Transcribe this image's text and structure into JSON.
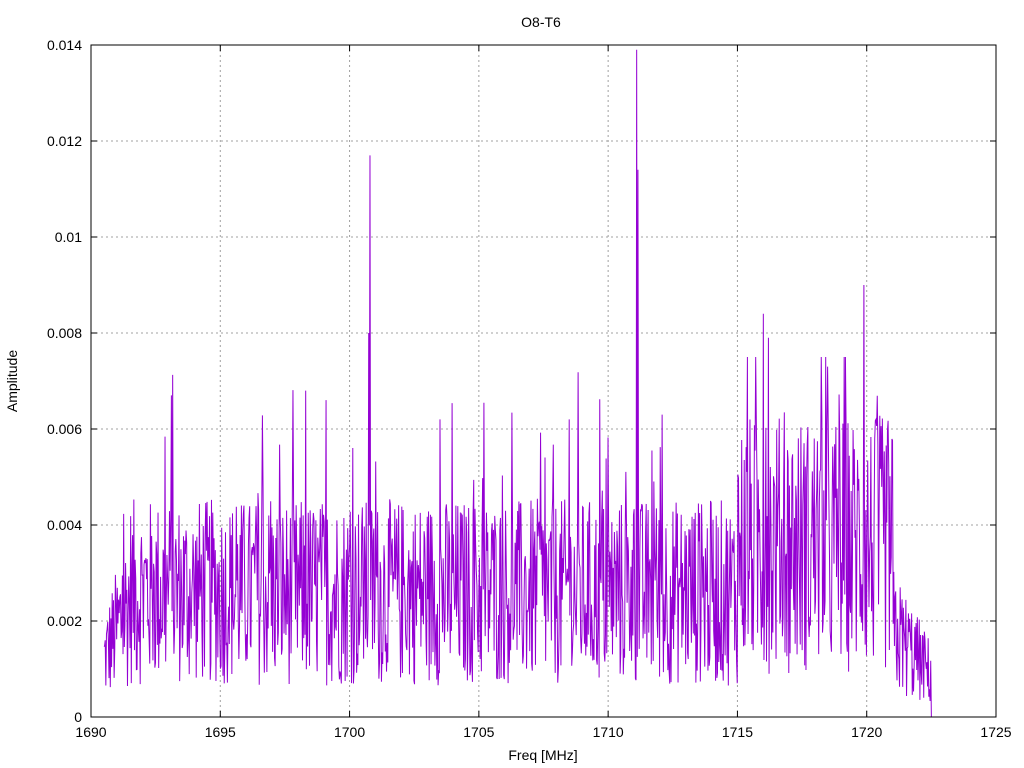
{
  "chart_data": {
    "type": "line",
    "title": "O8-T6",
    "xlabel": "Freq [MHz]",
    "ylabel": "Amplitude",
    "xlim": [
      1690,
      1725
    ],
    "ylim": [
      0,
      0.014
    ],
    "x_ticks": [
      1690,
      1695,
      1700,
      1705,
      1710,
      1715,
      1720,
      1725
    ],
    "x_tick_labels": [
      "1690",
      "1695",
      "1700",
      "1705",
      "1710",
      "1715",
      "1720",
      "1725"
    ],
    "y_ticks": [
      0,
      0.002,
      0.004,
      0.006,
      0.008,
      0.01,
      0.012,
      0.014
    ],
    "y_tick_labels": [
      "0",
      "0.002",
      "0.004",
      "0.006",
      "0.008",
      "0.01",
      "0.012",
      "0.014"
    ],
    "grid": true,
    "series_color": "#9400d3",
    "series": [
      {
        "x_start": 1690.5,
        "x_end": 1722.5,
        "peaks": [
          {
            "x": 1693.1,
            "y": 0.0067
          },
          {
            "x": 1698.3,
            "y": 0.0068
          },
          {
            "x": 1700.8,
            "y": 0.0117
          },
          {
            "x": 1700.75,
            "y": 0.008
          },
          {
            "x": 1703.5,
            "y": 0.0062
          },
          {
            "x": 1708.5,
            "y": 0.0062
          },
          {
            "x": 1711.1,
            "y": 0.0139
          },
          {
            "x": 1711.15,
            "y": 0.0114
          },
          {
            "x": 1712.1,
            "y": 0.0063
          },
          {
            "x": 1716.0,
            "y": 0.0084
          },
          {
            "x": 1716.2,
            "y": 0.0079
          },
          {
            "x": 1718.5,
            "y": 0.0073
          },
          {
            "x": 1719.9,
            "y": 0.009
          },
          {
            "x": 1720.3,
            "y": 0.0058
          }
        ]
      }
    ]
  }
}
